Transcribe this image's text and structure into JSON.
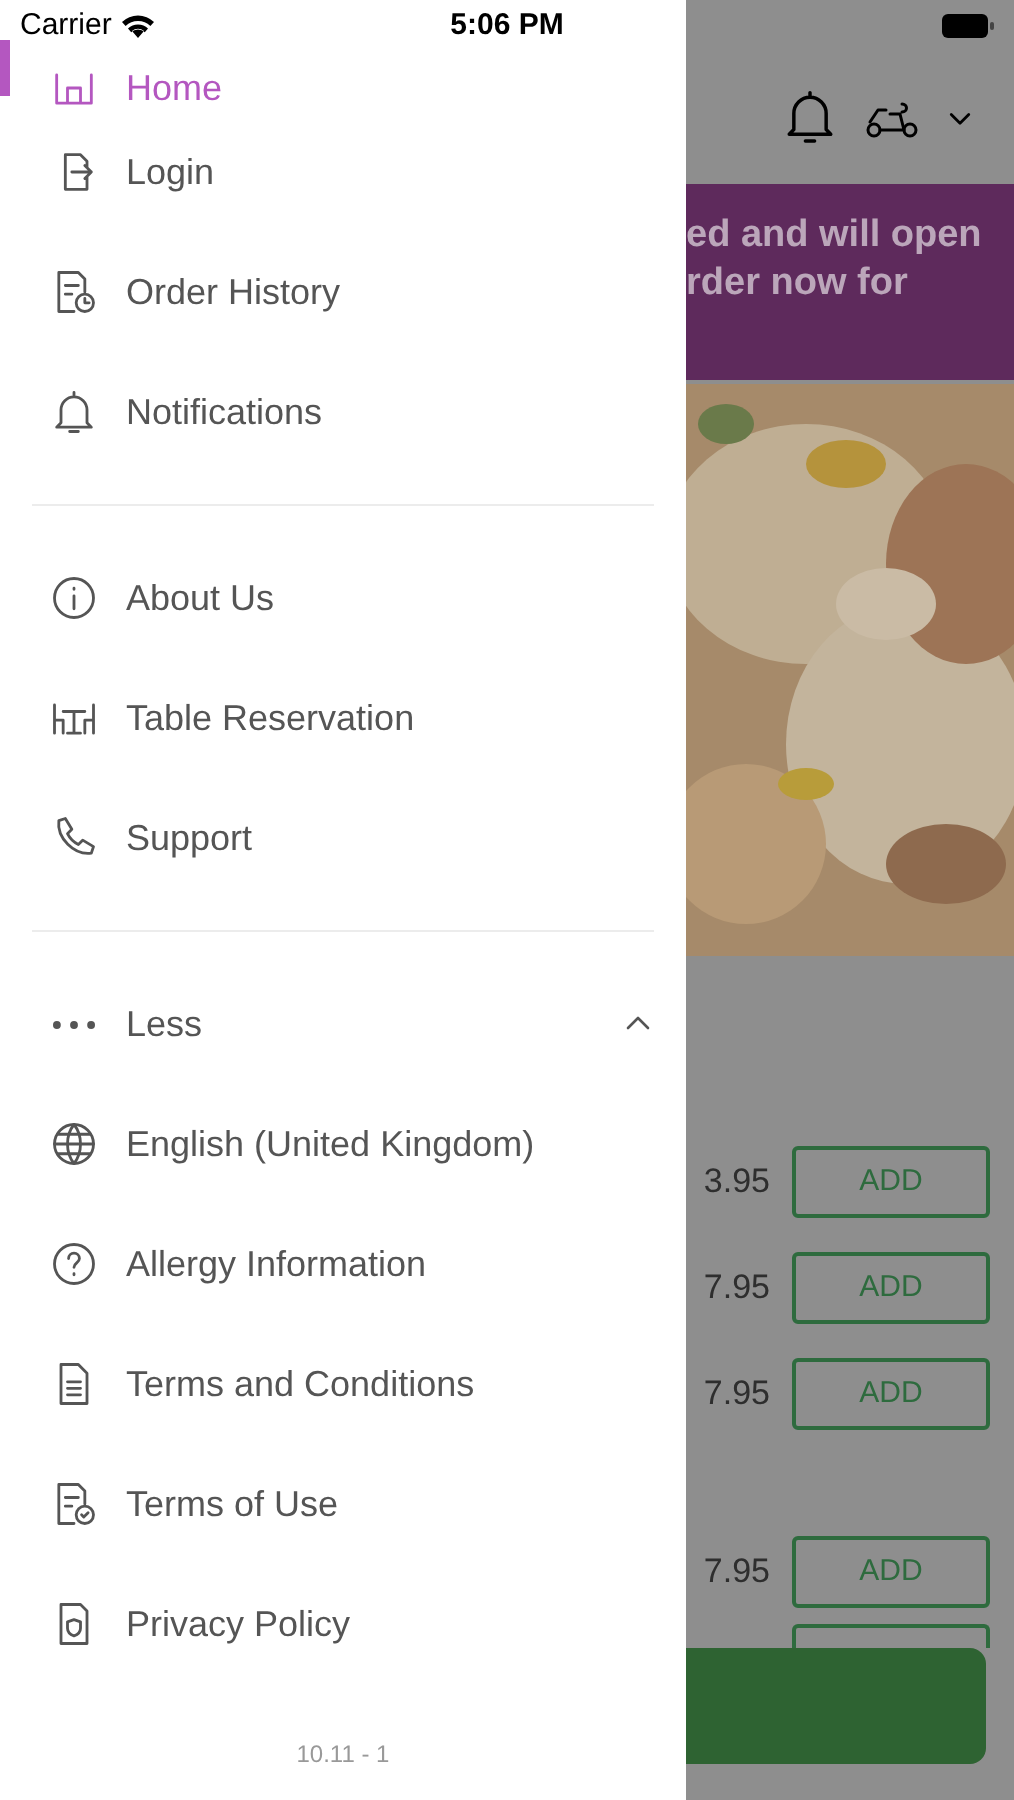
{
  "status_bar": {
    "carrier": "Carrier",
    "time": "5:06 PM"
  },
  "drawer": {
    "main_items": [
      {
        "label": "Home",
        "selected": true
      },
      {
        "label": "Login",
        "selected": false
      },
      {
        "label": "Order History",
        "selected": false
      },
      {
        "label": "Notifications",
        "selected": false
      }
    ],
    "info_items": [
      {
        "label": "About Us",
        "selected": false
      },
      {
        "label": "Table Reservation",
        "selected": false
      },
      {
        "label": "Support",
        "selected": false
      }
    ],
    "more_toggle": {
      "label": "Less",
      "expanded": true
    },
    "more_items": [
      {
        "label": "English (United Kingdom)",
        "selected": false
      },
      {
        "label": "Allergy Information",
        "selected": false
      },
      {
        "label": "Terms and Conditions",
        "selected": false
      },
      {
        "label": "Terms of Use",
        "selected": false
      },
      {
        "label": "Privacy Policy",
        "selected": false
      }
    ],
    "version": "10.11 - 1"
  },
  "background": {
    "banner_lines": [
      "ed and will open",
      "rder now for"
    ],
    "menu_rows": [
      {
        "price": "3.95",
        "button": "ADD"
      },
      {
        "price": "7.95",
        "button": "ADD"
      },
      {
        "price": "7.95",
        "button": "ADD"
      },
      {
        "price": "7.95",
        "button": "ADD"
      }
    ]
  }
}
